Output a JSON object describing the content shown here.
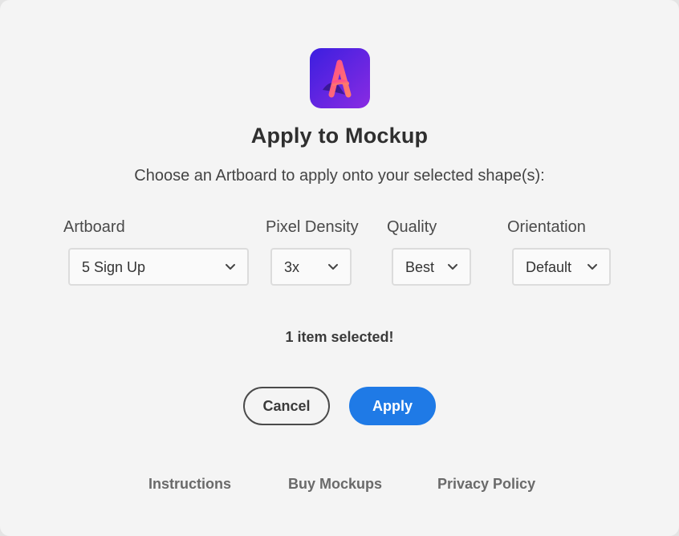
{
  "dialog": {
    "title": "Apply to Mockup",
    "subtitle": "Choose an Artboard to apply onto your selected shape(s):",
    "app_icon": "mockup-app-logo-icon"
  },
  "fields": {
    "artboard": {
      "label": "Artboard",
      "value": "5 Sign Up"
    },
    "pixel_density": {
      "label": "Pixel Density",
      "value": "3x"
    },
    "quality": {
      "label": "Quality",
      "value": "Best"
    },
    "orientation": {
      "label": "Orientation",
      "value": "Default"
    }
  },
  "status": "1 item selected!",
  "buttons": {
    "cancel": "Cancel",
    "apply": "Apply"
  },
  "footer": {
    "instructions": "Instructions",
    "buy": "Buy Mockups",
    "privacy": "Privacy Policy"
  },
  "colors": {
    "accent": "#1f7ae6",
    "logo_gradient_start": "#3b1fe0",
    "logo_gradient_end": "#8a2be2",
    "logo_letter": "#ff5a7a"
  }
}
